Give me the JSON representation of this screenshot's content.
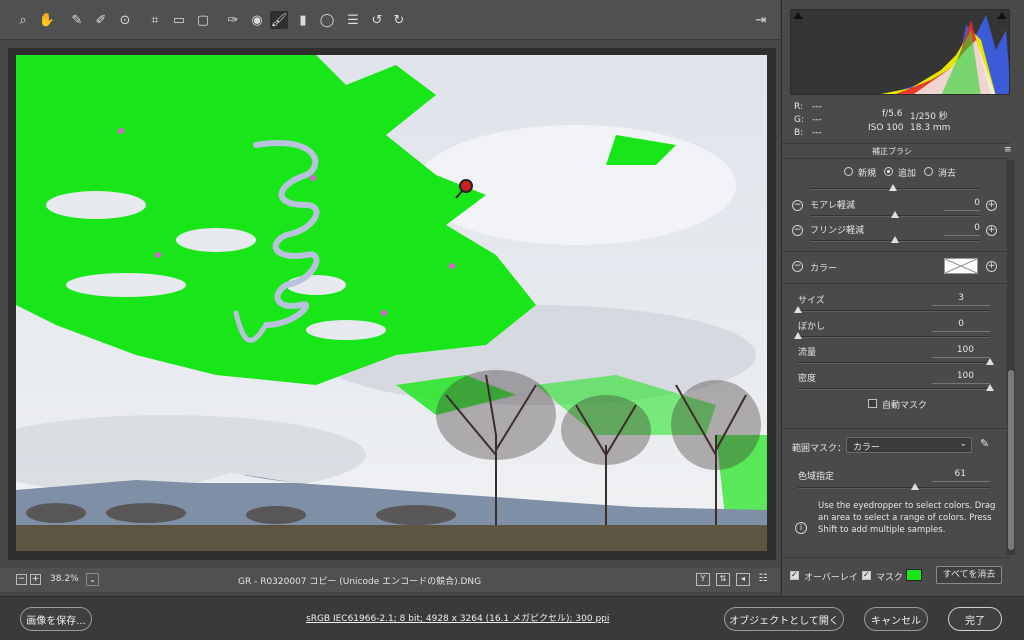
{
  "toolbar": {
    "tools": [
      "zoom-icon",
      "hand-icon",
      "white-balance-icon",
      "color-sampler-icon",
      "targeted-adjustment-icon",
      "crop-icon",
      "straighten-icon",
      "transform-icon",
      "spot-removal-icon",
      "red-eye-icon",
      "adjustment-brush-icon",
      "graduated-filter-icon",
      "radial-filter-icon",
      "list-icon",
      "rotate-ccw-icon",
      "rotate-cw-icon"
    ],
    "active_tool": "adjustment-brush-icon"
  },
  "status": {
    "zoom": "38.2%",
    "filename": "GR  -  R0320007 コピー (Unicode エンコードの競合).DNG"
  },
  "bottom": {
    "save_button": "画像を保存...",
    "workflow_link": "sRGB IEC61966-2.1; 8 bit; 4928 x 3264 (16.1 メガピクセル); 300 ppi",
    "open_object_button": "オブジェクトとして開く",
    "cancel_button": "キャンセル",
    "done_button": "完了"
  },
  "histogram": {
    "r": "R:",
    "g": "G:",
    "b": "B:",
    "r_val": "---",
    "g_val": "---",
    "b_val": "---"
  },
  "exif": {
    "aperture": "f/5.6",
    "shutter": "1/250 秒",
    "iso": "ISO 100",
    "focal": "18.3 mm"
  },
  "panel": {
    "title": "補正ブラシ",
    "modes": [
      "新規",
      "追加",
      "消去"
    ],
    "selected_mode": "追加",
    "moire_label": "モアレ軽減",
    "moire_value": "0",
    "fringe_label": "フリンジ軽減",
    "fringe_value": "0",
    "color_label": "カラー",
    "size_label": "サイズ",
    "size_value": "3",
    "feather_label": "ぼかし",
    "feather_value": "0",
    "flow_label": "流量",
    "flow_value": "100",
    "density_label": "密度",
    "density_value": "100",
    "automask_label": "自動マスク",
    "range_mask_label": "範囲マスク：",
    "range_mask_option": "カラー",
    "color_range_label": "色域指定",
    "color_range_value": "61",
    "help_text": "Use the eyedropper to select colors. Drag an area to select a range of colors. Press Shift to add multiple samples.",
    "overlay_label": "オーバーレイ",
    "mask_label": "マスク",
    "mask_color": "#19e619",
    "clear_all_button": "すべてを消去"
  },
  "slider_levels": {
    "size": 0.0,
    "feather": 0.0,
    "flow": 1.0,
    "density": 1.0,
    "color_range": 0.61,
    "moire": 0.5,
    "fringe": 0.5
  }
}
